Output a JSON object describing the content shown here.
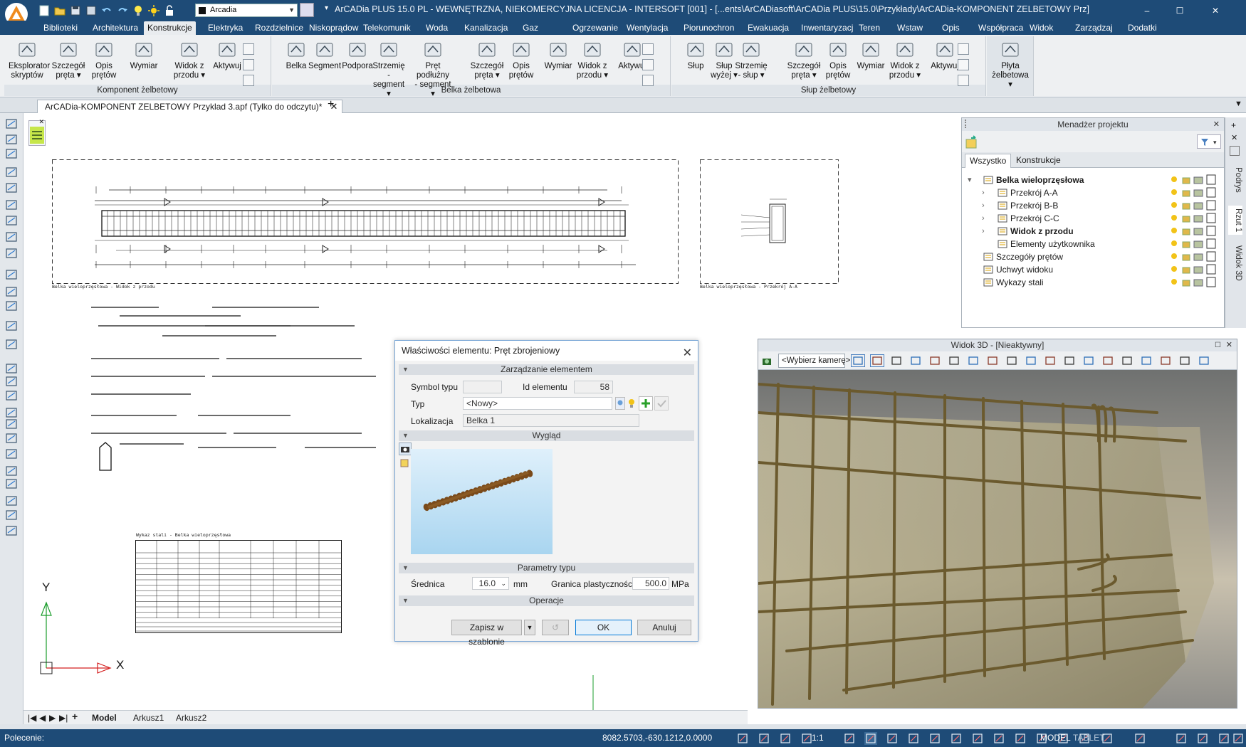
{
  "app": {
    "title": "ArCADia PLUS 15.0 PL - WEWNĘTRZNA, NIEKOMERCYJNA LICENCJA - INTERSOFT [001] - [...ents\\ArCADiasoft\\ArCADia PLUS\\15.0\\Przykłady\\ArCADia-KOMPONENT ZELBETOWY Prz]",
    "layer_combo": "Arcadia",
    "controls": {
      "minimize": "–",
      "maximize": "☐",
      "close": "✕"
    }
  },
  "menu_tabs": [
    "Biblioteki",
    "Architektura",
    "Konstrukcje",
    "Elektryka",
    "Rozdzielnice",
    "Niskoprądow",
    "Telekomunik",
    "Woda",
    "Kanalizacja",
    "Gaz",
    "Ogrzewanie",
    "Wentylacja",
    "Piorunochron",
    "Ewakuacja",
    "Inwentaryzacj",
    "Teren",
    "Wstaw",
    "Opis",
    "Współpraca",
    "Widok",
    "Zarządzaj",
    "Dodatki"
  ],
  "menu_active": "Konstrukcje",
  "ribbon": {
    "groups": [
      {
        "label": "Komponent żelbetowy",
        "buttons": [
          {
            "l1": "Eksplorator",
            "l2": "skryptów"
          },
          {
            "l1": "Szczegół",
            "l2": "pręta ▾"
          },
          {
            "l1": "Opis",
            "l2": "prętów"
          },
          {
            "l1": "Wymiar",
            "l2": ""
          },
          {
            "l1": "Widok z",
            "l2": "przodu ▾"
          },
          {
            "l1": "Aktywuj",
            "l2": ""
          }
        ]
      },
      {
        "label": "Belka żelbetowa",
        "buttons": [
          {
            "l1": "Belka",
            "l2": ""
          },
          {
            "l1": "Segment",
            "l2": ""
          },
          {
            "l1": "Podpora",
            "l2": ""
          },
          {
            "l1": "Strzemię -",
            "l2": "segment ▾"
          },
          {
            "l1": "Pręt podłużny",
            "l2": "- segment ▾"
          },
          {
            "l1": "Szczegół",
            "l2": "pręta ▾"
          },
          {
            "l1": "Opis",
            "l2": "prętów"
          },
          {
            "l1": "Wymiar",
            "l2": ""
          },
          {
            "l1": "Widok z",
            "l2": "przodu ▾"
          },
          {
            "l1": "Aktywuj",
            "l2": ""
          }
        ]
      },
      {
        "label": "Słup żelbetowy",
        "buttons": [
          {
            "l1": "Słup",
            "l2": ""
          },
          {
            "l1": "Słup",
            "l2": "wyżej ▾"
          },
          {
            "l1": "Strzemię",
            "l2": "- słup ▾"
          },
          {
            "l1": "Szczegół",
            "l2": "pręta ▾"
          },
          {
            "l1": "Opis",
            "l2": "prętów"
          },
          {
            "l1": "Wymiar",
            "l2": ""
          },
          {
            "l1": "Widok z",
            "l2": "przodu ▾"
          },
          {
            "l1": "Aktywuj",
            "l2": ""
          }
        ]
      },
      {
        "label": "",
        "buttons": [
          {
            "l1": "Płyta",
            "l2": "żelbetowa ▾"
          }
        ]
      }
    ]
  },
  "doc_tab": {
    "label": "ArCADia-KOMPONENT ZELBETOWY Przyklad 3.apf (Tylko do odczytu)*",
    "close": "✕",
    "add": "+"
  },
  "drawing": {
    "caption_front": "Belka wieloprzęsłowa - Widok z przodu",
    "caption_section": "Belka wieloprzęsłowa - Przekrój A-A",
    "table_title": "Wykaz stali - Belka wieloprzęsłowa",
    "axis_y": "Y",
    "axis_x": "X"
  },
  "project_manager": {
    "title": "Menadżer projektu",
    "close": "✕",
    "tabs": [
      "Wszystko",
      "Konstrukcje"
    ],
    "active_tab": "Wszystko",
    "tree": [
      {
        "label": "Belka wieloprzęsłowa",
        "level": 0,
        "bold": true,
        "expander": "▾"
      },
      {
        "label": "Przekrój A-A",
        "level": 1,
        "bold": false,
        "expander": "›"
      },
      {
        "label": "Przekrój B-B",
        "level": 1,
        "bold": false,
        "expander": "›"
      },
      {
        "label": "Przekrój C-C",
        "level": 1,
        "bold": false,
        "expander": "›"
      },
      {
        "label": "Widok z przodu",
        "level": 1,
        "bold": true,
        "expander": "›"
      },
      {
        "label": "Elementy użytkownika",
        "level": 1,
        "bold": false,
        "expander": ""
      },
      {
        "label": "Szczegóły prętów",
        "level": 0,
        "bold": false,
        "expander": ""
      },
      {
        "label": "Uchwyt widoku",
        "level": 0,
        "bold": false,
        "expander": ""
      },
      {
        "label": "Wykazy stali",
        "level": 0,
        "bold": false,
        "expander": ""
      }
    ]
  },
  "side_tabs": [
    "Podrys",
    "Rzut 1",
    "Widok 3D"
  ],
  "view3d": {
    "title": "Widok 3D - [Nieaktywny]",
    "camera": "<Wybierz kamerę>",
    "close": "✕",
    "max": "☐"
  },
  "dialog": {
    "title": "Właściwości elementu: Pręt zbrojeniowy",
    "close": "✕",
    "sections": {
      "management": "Zarządzanie elementem",
      "appearance": "Wygląd",
      "type_params": "Parametry typu",
      "operations": "Operacje"
    },
    "fields": {
      "symbol_label": "Symbol typu",
      "symbol_value": "",
      "id_label": "Id elementu",
      "id_value": "58",
      "type_label": "Typ",
      "type_value": "<Nowy>",
      "location_label": "Lokalizacja",
      "location_value": "Belka 1",
      "diameter_label": "Średnica",
      "diameter_value": "16.0",
      "diameter_unit": "mm",
      "yield_label": "Granica plastyczności",
      "yield_value": "500.0",
      "yield_unit": "MPa"
    },
    "buttons": {
      "save_template": "Zapisz w szablonie",
      "ok": "OK",
      "cancel": "Anuluj"
    }
  },
  "sheet_tabs": [
    "Model",
    "Arkusz1",
    "Arkusz2"
  ],
  "sheet_active": "Model",
  "status": {
    "command_label": "Polecenie:",
    "coords": "8082.5703,-630.1212,0.0000",
    "scale": "1:1",
    "model": "MODEL",
    "tablet": "TABLET"
  },
  "colors": {
    "title_bar": "#1e4b77",
    "rebar": "#6b5a2e",
    "accent": "#0078d7"
  }
}
